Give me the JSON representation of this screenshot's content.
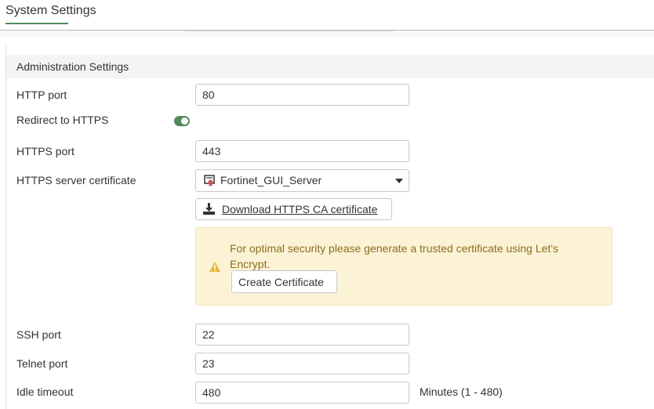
{
  "page": {
    "title": "System Settings"
  },
  "admin": {
    "section_title": "Administration Settings",
    "http_port": {
      "label": "HTTP port",
      "value": "80"
    },
    "redirect": {
      "label": "Redirect to HTTPS",
      "enabled": true
    },
    "https_port": {
      "label": "HTTPS port",
      "value": "443"
    },
    "https_cert": {
      "label": "HTTPS server certificate",
      "value": "Fortinet_GUI_Server"
    },
    "download_btn": "Download HTTPS CA certificate",
    "warning": {
      "text": "For optimal security please generate a trusted certificate using Let's Encrypt.",
      "button": "Create Certificate"
    },
    "ssh_port": {
      "label": "SSH port",
      "value": "22"
    },
    "telnet_port": {
      "label": "Telnet port",
      "value": "23"
    },
    "idle_timeout": {
      "label": "Idle timeout",
      "value": "480",
      "hint": "Minutes (1 - 480)"
    }
  },
  "colors": {
    "accent_green": "#4f8b5a",
    "warning_bg": "#fcf3d6",
    "warning_text": "#8a6d1f",
    "warning_icon": "#e9b93a",
    "cert_icon_red": "#d9534f"
  }
}
